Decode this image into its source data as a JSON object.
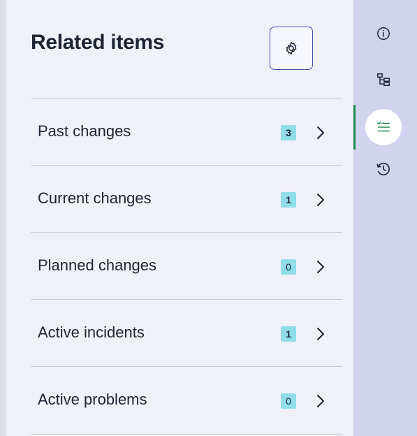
{
  "panel": {
    "title": "Related items",
    "settings_icon": "gear-icon"
  },
  "items": [
    {
      "label": "Past changes",
      "count": "3"
    },
    {
      "label": "Current changes",
      "count": "1"
    },
    {
      "label": "Planned changes",
      "count": "0"
    },
    {
      "label": "Active incidents",
      "count": "1"
    },
    {
      "label": "Active problems",
      "count": "0"
    }
  ],
  "rail": {
    "buttons": [
      {
        "icon": "info-icon",
        "active": false
      },
      {
        "icon": "hierarchy-icon",
        "active": false
      },
      {
        "icon": "checklist-icon",
        "active": true
      },
      {
        "icon": "history-icon",
        "active": false
      }
    ]
  },
  "colors": {
    "panel_bg": "#eff0f8",
    "rail_bg": "#d1d3ef",
    "badge_bg": "#8fdde8",
    "accent_border": "#3f4fa8",
    "active_indicator": "#1f8a4c",
    "text": "#1e2433"
  }
}
